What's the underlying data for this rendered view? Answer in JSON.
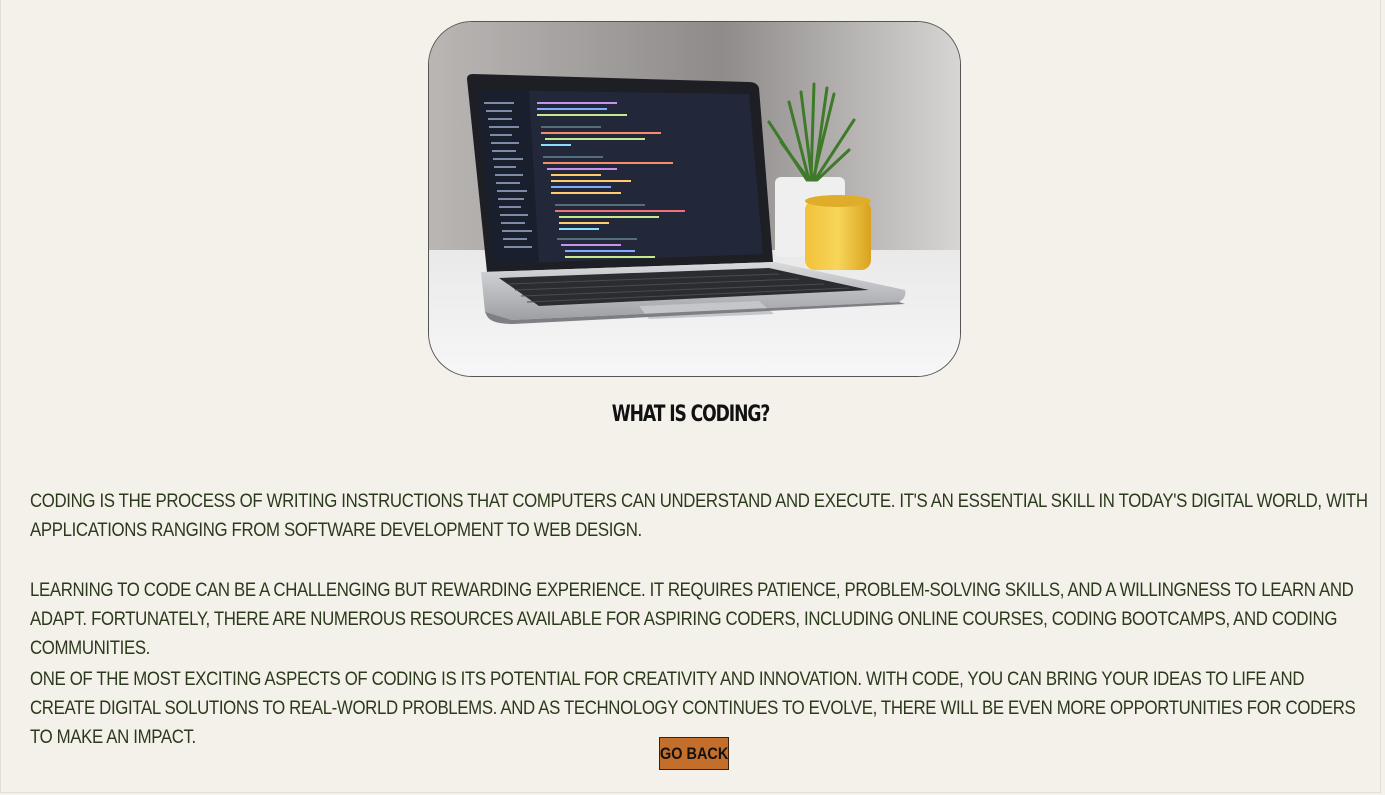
{
  "hero_image": {
    "alt": "Laptop showing code on a desk"
  },
  "heading": "What is Coding?",
  "paragraphs": [
    "Coding is the process of writing instructions that computers can understand and execute. It's an essential skill in today's digital world, with applications ranging from software development to web design.",
    "Learning to code can be a challenging but rewarding experience. It requires patience, problem-solving skills, and a willingness to learn and adapt. Fortunately, there are numerous resources available for aspiring coders, including online courses, coding bootcamps, and coding communities.",
    "One of the most exciting aspects of coding is its potential for creativity and innovation. With code, you can bring your ideas to life and create digital solutions to real-world problems. And as technology continues to evolve, there will be even more opportunities for coders to make an impact."
  ],
  "back_button": {
    "label": "Go Back"
  },
  "colors": {
    "background": "#f4f1ea",
    "text": "#2b3a1c",
    "button": "#c46e2b"
  }
}
